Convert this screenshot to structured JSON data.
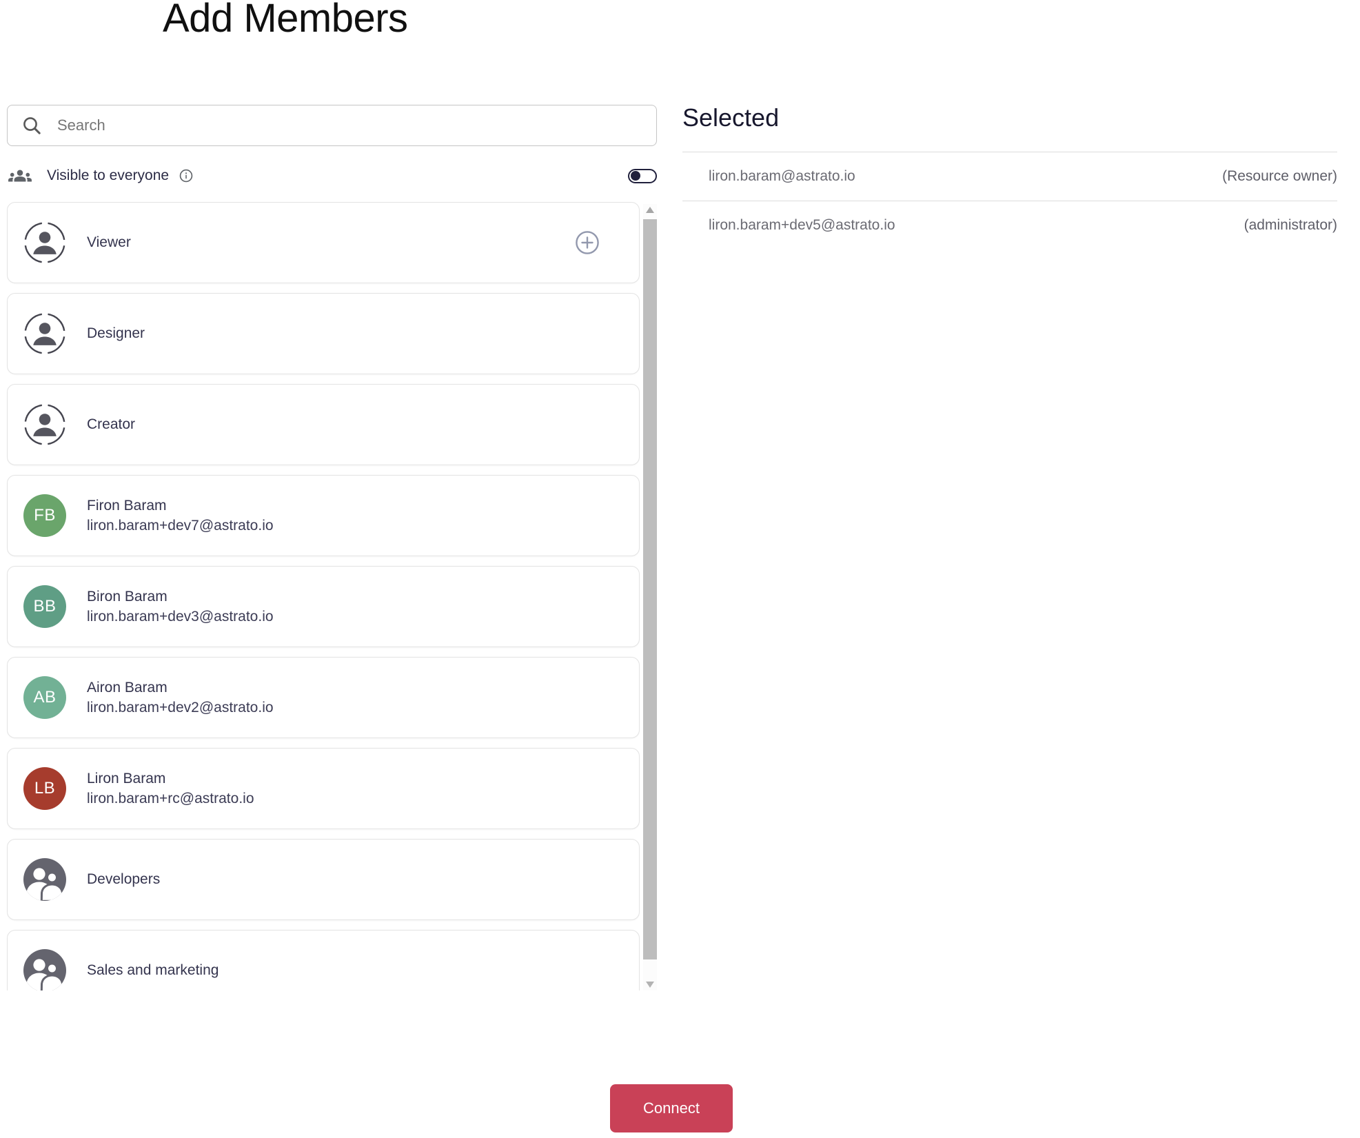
{
  "page": {
    "title": "Add Members"
  },
  "search": {
    "placeholder": "Search"
  },
  "visibility": {
    "label": "Visible to everyone",
    "toggle_state": "off"
  },
  "member_list": [
    {
      "type": "role",
      "label": "Viewer",
      "icon": "person-dashed-circle-icon",
      "has_add_button": true
    },
    {
      "type": "role",
      "label": "Designer",
      "icon": "person-dashed-circle-icon"
    },
    {
      "type": "role",
      "label": "Creator",
      "icon": "person-dashed-circle-icon"
    },
    {
      "type": "user",
      "name": "Firon Baram",
      "email": "liron.baram+dev7@astrato.io",
      "initials": "FB",
      "avatar_color": "#6aa56b"
    },
    {
      "type": "user",
      "name": "Biron Baram",
      "email": "liron.baram+dev3@astrato.io",
      "initials": "BB",
      "avatar_color": "#5f9e85"
    },
    {
      "type": "user",
      "name": "Airon Baram",
      "email": "liron.baram+dev2@astrato.io",
      "initials": "AB",
      "avatar_color": "#72b195"
    },
    {
      "type": "user",
      "name": "Liron Baram",
      "email": "liron.baram+rc@astrato.io",
      "initials": "LB",
      "avatar_color": "#a63c2d"
    },
    {
      "type": "group",
      "label": "Developers",
      "icon": "people-group-circle-icon"
    },
    {
      "type": "group",
      "label": "Sales and marketing",
      "icon": "people-group-circle-icon"
    }
  ],
  "selected": {
    "heading": "Selected",
    "items": [
      {
        "email": "liron.baram@astrato.io",
        "role": "(Resource owner)"
      },
      {
        "email": "liron.baram+dev5@astrato.io",
        "role": "(administrator)"
      }
    ]
  },
  "footer": {
    "connect_label": "Connect"
  },
  "colors": {
    "connect_button": "#c94157"
  }
}
